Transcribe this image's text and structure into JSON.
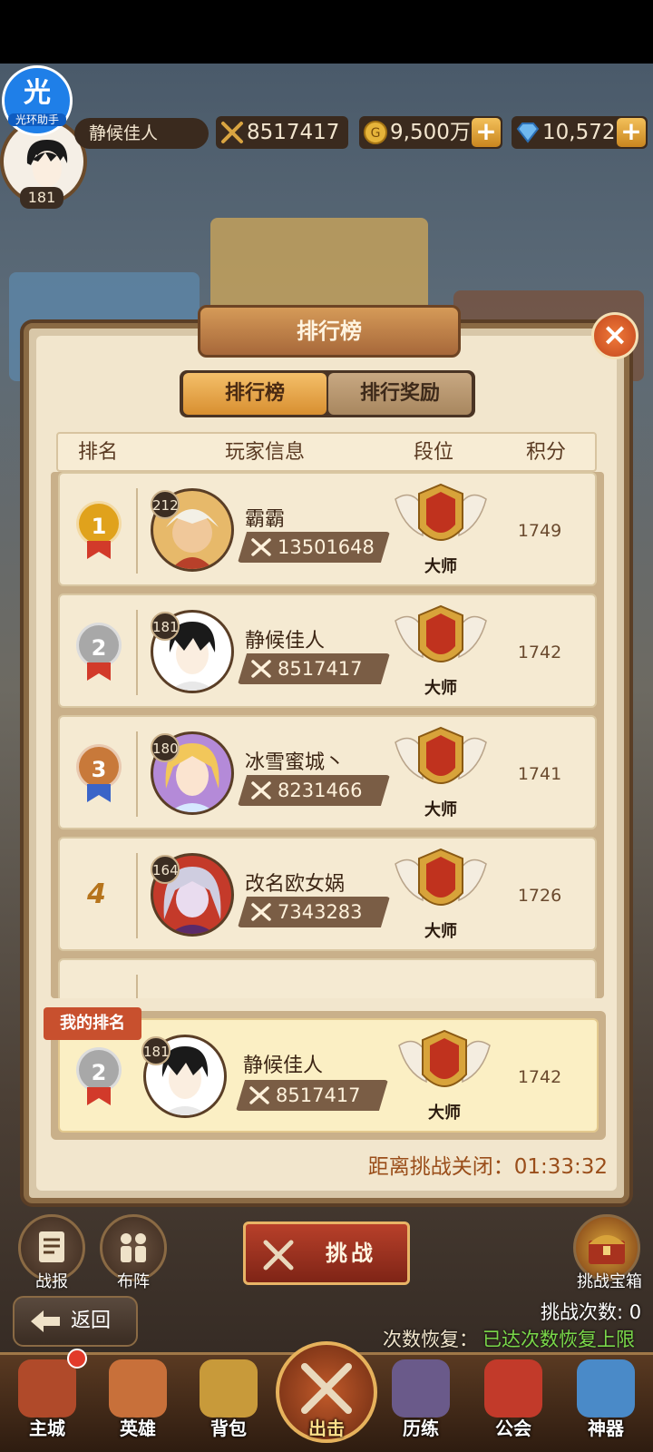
{
  "header": {
    "app_badge_char": "光",
    "app_badge_text": "光环助手",
    "player_level": "181",
    "player_name": "静候佳人",
    "combat_power": "8517417",
    "gold": "9,500万",
    "diamonds": "10,572",
    "plus_label": "+"
  },
  "panel": {
    "title": "排行榜",
    "close_label": "×",
    "tabs": [
      {
        "label": "排行榜",
        "active": true
      },
      {
        "label": "排行奖励",
        "active": false
      }
    ],
    "columns": [
      "排名",
      "玩家信息",
      "段位",
      "积分"
    ]
  },
  "rows": [
    {
      "rank": "1",
      "level": "212",
      "name": "霸霸",
      "power": "13501648",
      "tier": "大师",
      "score": "1749",
      "medal": "gold"
    },
    {
      "rank": "2",
      "level": "181",
      "name": "静候佳人",
      "power": "8517417",
      "tier": "大师",
      "score": "1742",
      "medal": "silver"
    },
    {
      "rank": "3",
      "level": "180",
      "name": "冰雪蜜城丶",
      "power": "8231466",
      "tier": "大师",
      "score": "1741",
      "medal": "bronze"
    },
    {
      "rank": "4",
      "level": "164",
      "name": "改名欧女娲",
      "power": "7343283",
      "tier": "大师",
      "score": "1726",
      "medal": "none"
    }
  ],
  "my_rank": {
    "tag": "我的排名",
    "rank": "2",
    "level": "181",
    "name": "静候佳人",
    "power": "8517417",
    "tier": "大师",
    "score": "1742"
  },
  "countdown": {
    "label": "距离挑战关闭：",
    "value": "01:33:32"
  },
  "controls": {
    "battle_report": "战报",
    "formation": "布阵",
    "challenge": "挑战",
    "chest": "挑战宝箱",
    "attempts": "挑战次数: 0",
    "recovery_label": "次数恢复：",
    "recovery_value": "已达次数恢复上限",
    "back": "返回"
  },
  "nav": [
    {
      "label": "主城"
    },
    {
      "label": "英雄"
    },
    {
      "label": "背包"
    },
    {
      "label": "出击"
    },
    {
      "label": "历练"
    },
    {
      "label": "公会"
    },
    {
      "label": "神器"
    }
  ],
  "colors": {
    "gold_medal": "#e0a21c",
    "silver_medal": "#a8a8a8",
    "bronze_medal": "#c8793a",
    "recovery_value": "#7ad84a"
  }
}
